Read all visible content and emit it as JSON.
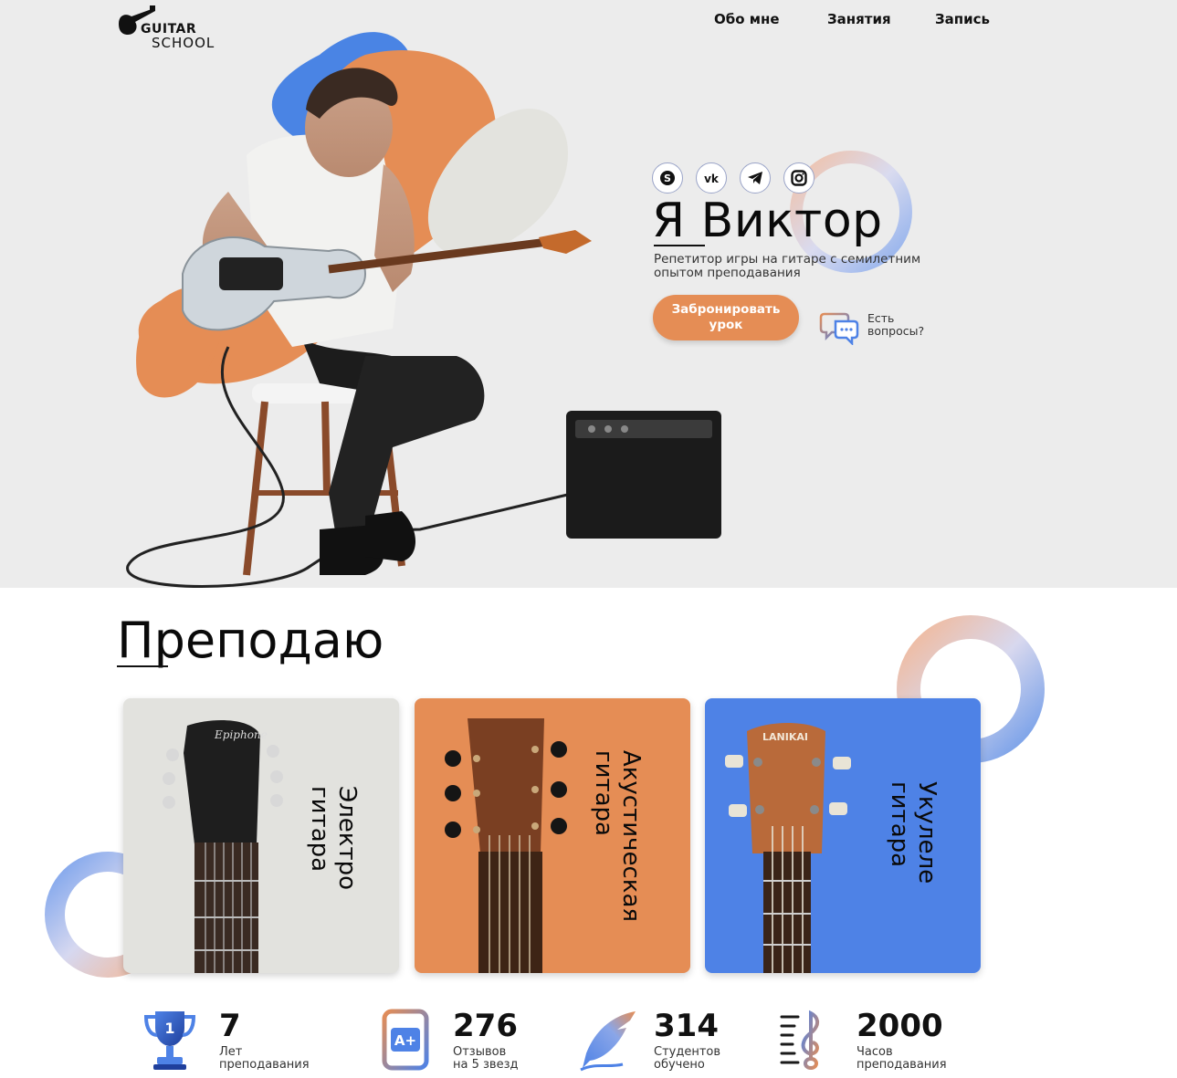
{
  "logo": {
    "line1": "GUITAR",
    "line2": "SCHOOL",
    "icon": "guitar-logo-icon"
  },
  "nav": {
    "items": [
      "Обо мне",
      "Занятия",
      "Запись"
    ]
  },
  "hero": {
    "name": "Я Виктор",
    "subtitle": "Репетитор игры на гитаре с семилетним опытом преподавания",
    "book_button": "Забронировать урок",
    "questions_text": "Есть вопросы?",
    "socials": [
      "skype-icon",
      "vk-icon",
      "telegram-icon",
      "instagram-icon"
    ]
  },
  "teach": {
    "title": "Преподаю",
    "cards": [
      {
        "label": "Электро гитара",
        "color": "#e2e2de"
      },
      {
        "label": "Акустическая гитара",
        "color": "#e58d55"
      },
      {
        "label": "Укулеле гитара",
        "color": "#4e82e6"
      }
    ]
  },
  "stats": [
    {
      "value": "7",
      "caption_line1": "Лет",
      "caption_line2": "преподавания",
      "icon": "trophy-icon"
    },
    {
      "value": "276",
      "caption_line1": "Отзывов",
      "caption_line2": "на 5 звезд",
      "icon": "a-plus-icon"
    },
    {
      "value": "314",
      "caption_line1": "Студентов",
      "caption_line2": "обучено",
      "icon": "quill-icon"
    },
    {
      "value": "2000",
      "caption_line1": "Часов",
      "caption_line2": "преподавания",
      "icon": "music-notes-icon"
    }
  ],
  "colors": {
    "accent_orange": "#e58d55",
    "accent_blue": "#4e82e6",
    "hero_bg": "#ececec",
    "text": "#0a0a0a"
  }
}
